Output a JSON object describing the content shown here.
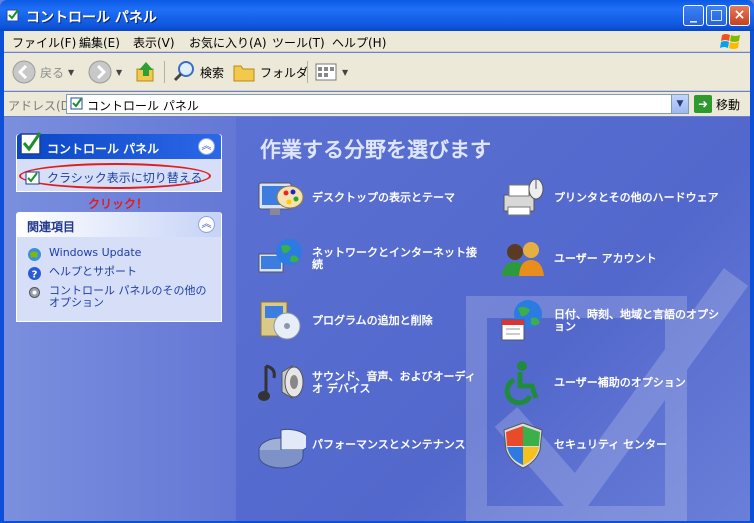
{
  "window": {
    "title": "コントロール パネル",
    "buttons": {
      "minimize": "_",
      "maximize": "□",
      "close": "×"
    }
  },
  "menubar": {
    "items": [
      "ファイル(F)",
      "編集(E)",
      "表示(V)",
      "お気に入り(A)",
      "ツール(T)",
      "ヘルプ(H)"
    ]
  },
  "toolbar": {
    "back": "戻る",
    "search": "検索",
    "folders": "フォルダ"
  },
  "address": {
    "label": "アドレス(D)",
    "value": "コントロール パネル",
    "go": "移動"
  },
  "leftpane": {
    "cp_box": {
      "title": "コントロール パネル",
      "switch_link": "クラシック表示に切り替える"
    },
    "annotation": "クリック！",
    "related": {
      "title": "関連項目",
      "items": [
        "Windows Update",
        "ヘルプとサポート",
        "コントロール パネルのその他のオプション"
      ]
    }
  },
  "main": {
    "heading": "作業する分野を選びます",
    "categories": [
      {
        "label": "デスクトップの表示とテーマ",
        "icon": "display-icon"
      },
      {
        "label": "プリンタとその他のハードウェア",
        "icon": "printer-icon"
      },
      {
        "label": "ネットワークとインターネット接続",
        "icon": "network-icon"
      },
      {
        "label": "ユーザー アカウント",
        "icon": "users-icon"
      },
      {
        "label": "プログラムの追加と削除",
        "icon": "programs-icon"
      },
      {
        "label": "日付、時刻、地域と言語のオプション",
        "icon": "datetime-icon"
      },
      {
        "label": "サウンド、音声、およびオーディオ デバイス",
        "icon": "sound-icon"
      },
      {
        "label": "ユーザー補助のオプション",
        "icon": "accessibility-icon"
      },
      {
        "label": "パフォーマンスとメンテナンス",
        "icon": "performance-icon"
      },
      {
        "label": "セキュリティ センター",
        "icon": "security-icon"
      }
    ]
  },
  "colors": {
    "titlebar": "#0a5ae6",
    "pane_bg": "#6b7fd6",
    "annotation_red": "#e21c1c"
  }
}
